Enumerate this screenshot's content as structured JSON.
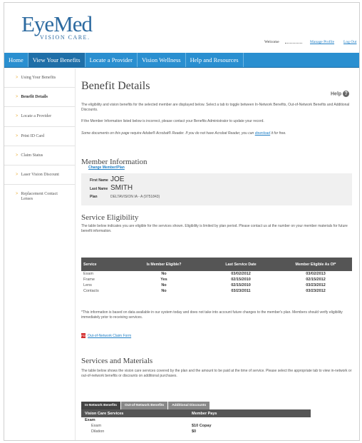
{
  "header": {
    "logo_main": "EyeMed",
    "logo_sub": "VISION CARE.",
    "welcome_label": "Welcome",
    "manage_profile": "Manage Profile",
    "log_out": "Log Out"
  },
  "nav": {
    "items": [
      {
        "label": "Home"
      },
      {
        "label": "View Your Benefits"
      },
      {
        "label": "Locate a Provider"
      },
      {
        "label": "Vision Wellness"
      },
      {
        "label": "Help and Resources"
      }
    ]
  },
  "sidebar": {
    "items": [
      {
        "label": "Using Your Benefits"
      },
      {
        "label": "Benefit Details"
      },
      {
        "label": "Locate a Provider"
      },
      {
        "label": "Print ID Card"
      },
      {
        "label": "Claim Status"
      },
      {
        "label": "Laser Vision Discount"
      },
      {
        "label": "Replacement Contact Lenses"
      }
    ]
  },
  "page": {
    "title": "Benefit Details",
    "help_label": "Help",
    "intro1": "The eligibility and vision benefits for the selected member are displayed below. Select a tab to toggle between In-Network Benefits, Out-of-Network Benefits and Additional Discounts.",
    "intro2": "If the Member Information listed below is incorrect, please contact your Benefits Administrator to update your record.",
    "acrobat_note_pre": "Some documents on this page require Adobe® Acrobat® Reader. If you do not have Acrobat Reader, you can ",
    "acrobat_link": "download",
    "acrobat_note_post": " it for free."
  },
  "member": {
    "title": "Member Information",
    "change_link": "Change Member/Plan",
    "first_name_label": "First Name",
    "first_name": "JOE",
    "last_name_label": "Last Name",
    "last_name": "SMITH",
    "plan_label": "Plan",
    "plan": "DELTAVISION IA - A (9751843)"
  },
  "eligibility": {
    "title": "Service Eligibility",
    "desc": "The table below indicates you are eligible for the services shown. Eligibility is limited by plan period. Please contact us at the number on your member materials for future benefit information.",
    "columns": [
      "Service",
      "Is Member Eligible?",
      "Last Service Date",
      "Member Eligible As Of*"
    ],
    "rows": [
      [
        "Exam",
        "No",
        "03/02/2012",
        "03/02/2013"
      ],
      [
        "Frame",
        "Yes",
        "02/15/2010",
        "02/15/2012"
      ],
      [
        "Lens",
        "No",
        "02/15/2010",
        "03/23/2012"
      ],
      [
        "Contacts",
        "No",
        "03/23/2011",
        "03/23/2012"
      ]
    ],
    "footnote": "*This information is based on data available in our system today and does not take into account future changes to the member's plan. Members should verify eligibility immediately prior to receiving services.",
    "claim_form_link": "Out-of-Network Claim Form",
    "pdf_icon_text": "PDF"
  },
  "services": {
    "title": "Services and Materials",
    "desc": "The table below shows the vision care services covered by the plan and the amount to be paid at the time of service. Please select the appropriate tab to view in-network or out-of-network benefits or discounts on additional purchases.",
    "tabs": [
      "In-Network Benefits",
      "Out-of-Network Benefits",
      "Additional Discounts"
    ],
    "columns": [
      "Vision Care Services",
      "Member Pays"
    ],
    "group": "Exam",
    "rows": [
      [
        "Exam",
        "$10 Copay"
      ],
      [
        "Dilation",
        "$0"
      ]
    ]
  }
}
